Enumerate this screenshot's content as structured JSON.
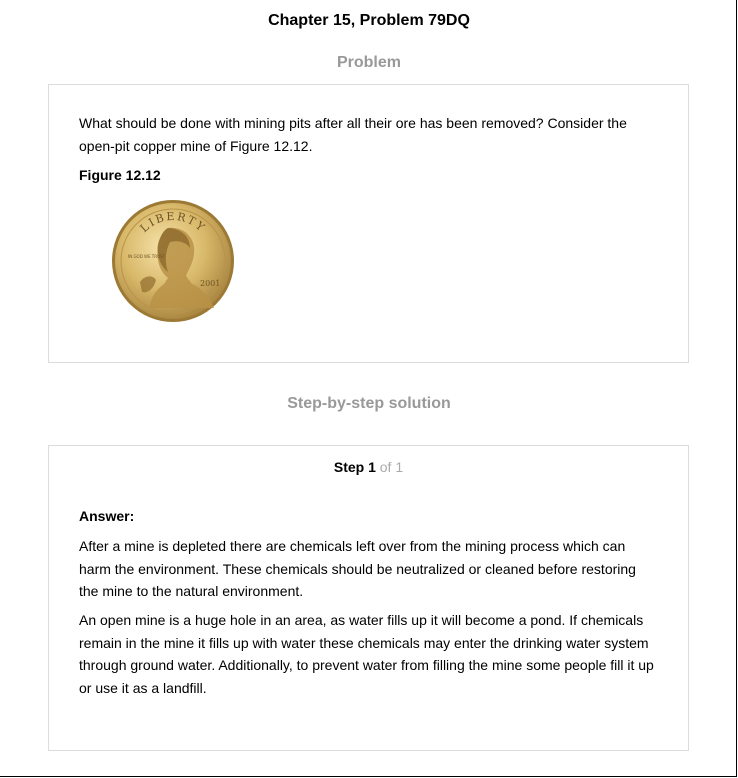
{
  "header": {
    "title": "Chapter 15, Problem 79DQ"
  },
  "problem": {
    "heading": "Problem",
    "text": "What should be done with mining pits after all their ore has been removed? Consider the open-pit copper mine of Figure 12.12.",
    "figure_label": "Figure 12.12",
    "coin": {
      "top_text": "LIBERTY",
      "motto": "IN GOD WE TRUST",
      "year": "2001",
      "colors": {
        "gold": "#d8b766",
        "gold_dark": "#8a6a2a",
        "gold_light": "#f3dea0"
      }
    }
  },
  "solution": {
    "heading": "Step-by-step solution",
    "step_label": "Step 1",
    "step_of": "of 1",
    "answer_label": "Answer:",
    "paragraphs": [
      "After a mine is depleted there are chemicals left over from the mining process which can harm the environment. These chemicals should be neutralized or cleaned before restoring the mine to the natural environment.",
      "An open mine is a huge hole in an area, as water fills up it will become a pond. If chemicals remain in the mine it fills up with water these chemicals may enter the drinking water system through ground water. Additionally, to prevent water from filling the mine some people fill it up or use it as a landfill."
    ]
  },
  "colors": {
    "heading_gray": "#999999",
    "border": "#dcdcdc",
    "muted": "#aaaaaa"
  }
}
